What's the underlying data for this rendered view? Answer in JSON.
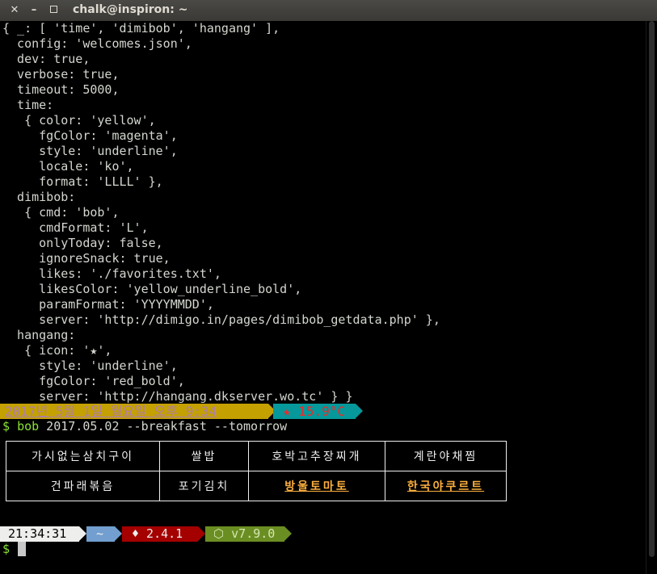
{
  "window": {
    "title": "chalk@inspiron: ~",
    "buttons": {
      "close": "✕",
      "minimize": "–"
    }
  },
  "terminal": {
    "output_lines": [
      "{ _: [ 'time', 'dimibob', 'hangang' ],",
      "  config: 'welcomes.json',",
      "  dev: true,",
      "  verbose: true,",
      "  timeout: 5000,",
      "  time:",
      "   { color: 'yellow',",
      "     fgColor: 'magenta',",
      "     style: 'underline',",
      "     locale: 'ko',",
      "     format: 'LLLL' },",
      "  dimibob:",
      "   { cmd: 'bob',",
      "     cmdFormat: 'L',",
      "     onlyToday: false,",
      "     ignoreSnack: true,",
      "     likes: './favorites.txt',",
      "     likesColor: 'yellow_underline_bold',",
      "     paramFormat: 'YYYYMMDD',",
      "     server: 'http://dimigo.in/pages/dimibob_getdata.php' },",
      "  hangang:",
      "   { icon: '★',",
      "     style: 'underline',",
      "     fgColor: 'red_bold',",
      "     server: 'http://hangang.dkserver.wo.tc' } }"
    ],
    "date_bar": {
      "date": "2017년 5월 1일 월요일 오후 9:34",
      "temperature": "★ 15.9°C"
    },
    "command": {
      "prompt": "$",
      "name": "bob",
      "args": " 2017.05.02 --breakfast --tomorrow"
    },
    "menu": {
      "rows": [
        [
          "가시없는삼치구이",
          "쌀밥",
          "호박고추장찌개",
          "계란야채찜"
        ],
        [
          "건파래볶음",
          "포기김치",
          "방울토마토",
          "한국야쿠르트"
        ]
      ],
      "liked_color": "#fcaf3e"
    },
    "status_bar": {
      "time": "21:34:31",
      "dir": "~",
      "ruby": "♦ 2.4.1",
      "node": "⬡ v7.9.0"
    },
    "final_prompt": "$"
  }
}
